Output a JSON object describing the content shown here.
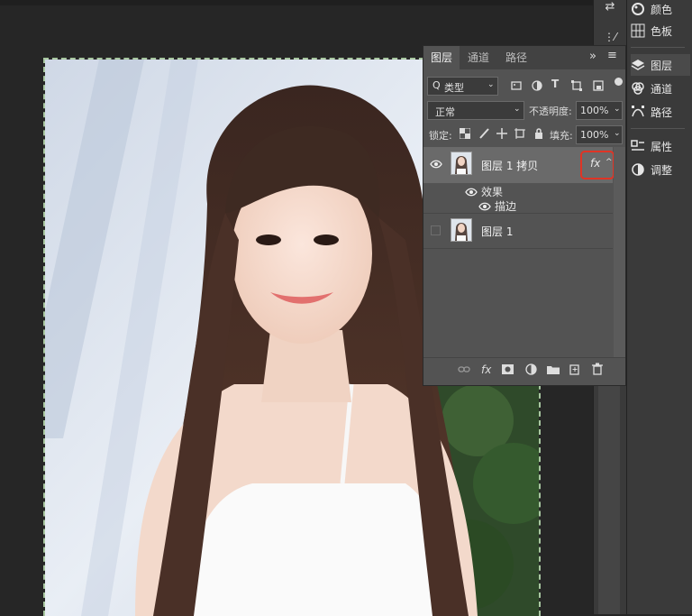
{
  "dock": {
    "items": [
      {
        "label": "颜色",
        "icon": "palette-icon"
      },
      {
        "label": "色板",
        "icon": "swatches-grid-icon"
      },
      {
        "label": "图层",
        "icon": "layers-icon"
      },
      {
        "label": "通道",
        "icon": "channels-icon"
      },
      {
        "label": "路径",
        "icon": "paths-icon"
      },
      {
        "label": "属性",
        "icon": "properties-icon"
      },
      {
        "label": "调整",
        "icon": "adjustments-icon"
      }
    ]
  },
  "layers_panel": {
    "tabs": [
      "图层",
      "通道",
      "路径"
    ],
    "active_tab": "图层",
    "collapse_glyph": "»",
    "menu_glyph": "≡",
    "filter": {
      "label": "类型",
      "prefix": "Q"
    },
    "blend_mode": "正常",
    "opacity_label": "不透明度:",
    "opacity_value": "100%",
    "lock_label": "锁定:",
    "fill_label": "填充:",
    "fill_value": "100%",
    "layers": [
      {
        "name": "图层 1 拷贝",
        "visible": true,
        "fx": "fx",
        "effects_label": "效果",
        "effect": "描边"
      },
      {
        "name": "图层 1",
        "visible": false
      }
    ],
    "bottom_fx": "fx"
  }
}
